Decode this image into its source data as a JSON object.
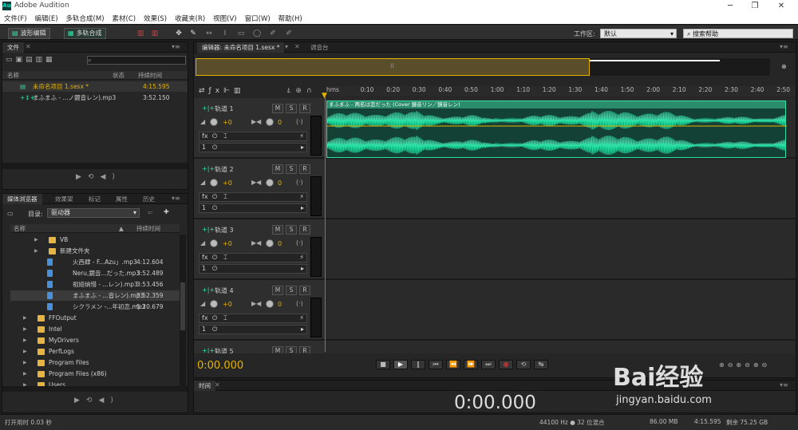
{
  "app": {
    "title": "Adobe Audition",
    "icon_text": "Au"
  },
  "window_controls": {
    "minimize": "─",
    "maximize": "❐",
    "close": "✕"
  },
  "menu": [
    "文件(F)",
    "编辑(E)",
    "多轨合成(M)",
    "素材(C)",
    "效果(S)",
    "收藏夹(R)",
    "视图(V)",
    "窗口(W)",
    "帮助(H)"
  ],
  "toolbar": {
    "waveform_mode": "波形编辑",
    "multitrack_mode": "多轨合成",
    "workspace_label": "工作区:",
    "workspace_value": "默认",
    "search_placeholder": "搜索帮助"
  },
  "files_panel": {
    "tab": "文件",
    "col_name": "名称",
    "col_status": "状态",
    "col_duration": "持续时间",
    "items": [
      {
        "name": "未命名项目 1.sesx *",
        "duration": "4:15.595"
      },
      {
        "name": "まふまふ - ...ノ鏡音レン).mp3",
        "duration": "3:52.150"
      }
    ]
  },
  "media_panel": {
    "tabs": [
      "媒体浏览器",
      "效果架",
      "标记",
      "属性",
      "历史"
    ],
    "dir_label": "目录:",
    "dir_value": "驱动器",
    "col_name": "名称",
    "col_duration": "持续时间",
    "items": [
      {
        "name": "VB",
        "type": "folder",
        "level": 2,
        "duration": ""
      },
      {
        "name": "新建文件夹",
        "type": "folder",
        "level": 2,
        "duration": ""
      },
      {
        "name": "火西肆 - F...Azu」.mp3",
        "type": "file",
        "level": 3,
        "duration": "4:12.604"
      },
      {
        "name": "Neru,鏡音...だった.mp3",
        "type": "file",
        "level": 3,
        "duration": "3:52.489"
      },
      {
        "name": "祖娅纳惜 - ...レン).mp3",
        "type": "file",
        "level": 3,
        "duration": "3:53.456"
      },
      {
        "name": "まふまふ - ...音レン).mp3",
        "type": "file",
        "level": 3,
        "duration": "3:52.359"
      },
      {
        "name": "シクラメン -...年初恋.mp3",
        "type": "file",
        "level": 3,
        "duration": "5:20.679"
      },
      {
        "name": "FFOutput",
        "type": "folder",
        "level": 1,
        "duration": ""
      },
      {
        "name": "Intel",
        "type": "folder",
        "level": 1,
        "duration": ""
      },
      {
        "name": "MyDrivers",
        "type": "folder",
        "level": 1,
        "duration": ""
      },
      {
        "name": "PerfLogs",
        "type": "folder",
        "level": 1,
        "duration": ""
      },
      {
        "name": "Program Files",
        "type": "folder",
        "level": 1,
        "duration": ""
      },
      {
        "name": "Program Files (x86)",
        "type": "folder",
        "level": 1,
        "duration": ""
      },
      {
        "name": "Users",
        "type": "folder",
        "level": 1,
        "duration": ""
      }
    ]
  },
  "editor": {
    "tab": "编辑器: 未命名项目 1.sesx *",
    "mixer_tab": "调音台",
    "ruler": [
      "hms",
      "0:10",
      "0:20",
      "0:30",
      "0:40",
      "0:50",
      "1:00",
      "1:10",
      "1:20",
      "1:30",
      "1:40",
      "1:50",
      "2:00",
      "2:10",
      "2:20",
      "2:30",
      "2:40",
      "2:50"
    ],
    "clip_name": "まふまふ - 两名は恋だった (Cover 鏡音リン／鏡音レン)",
    "tracks": [
      {
        "name": "轨道 1",
        "vol": "+0",
        "pan": "0",
        "ch": "1"
      },
      {
        "name": "轨道 2",
        "vol": "+0",
        "pan": "0",
        "ch": "1"
      },
      {
        "name": "轨道 3",
        "vol": "+0",
        "pan": "0",
        "ch": "1"
      },
      {
        "name": "轨道 4",
        "vol": "+0",
        "pan": "0",
        "ch": "1"
      },
      {
        "name": "轨道 5",
        "vol": "",
        "pan": "",
        "ch": ""
      }
    ],
    "track_btns": {
      "mute": "M",
      "solo": "S",
      "rec": "R"
    },
    "current_time": "0:00.000"
  },
  "time_panel": {
    "tab": "时间",
    "time": "0:00.000"
  },
  "status": {
    "left": "打开用时 0.03 秒",
    "sample": "44100 Hz ● 32 位混合",
    "mem": "86.00 MB",
    "dur": "4:15.595",
    "free": "剩余 75.25 GB"
  },
  "watermark": {
    "brand": "Bai经验",
    "url": "jingyan.baidu.com"
  },
  "colors": {
    "accent": "#e5b400",
    "wave": "#2fe3a8",
    "playhead": "#ff3f3f",
    "folder": "#e6b445"
  }
}
